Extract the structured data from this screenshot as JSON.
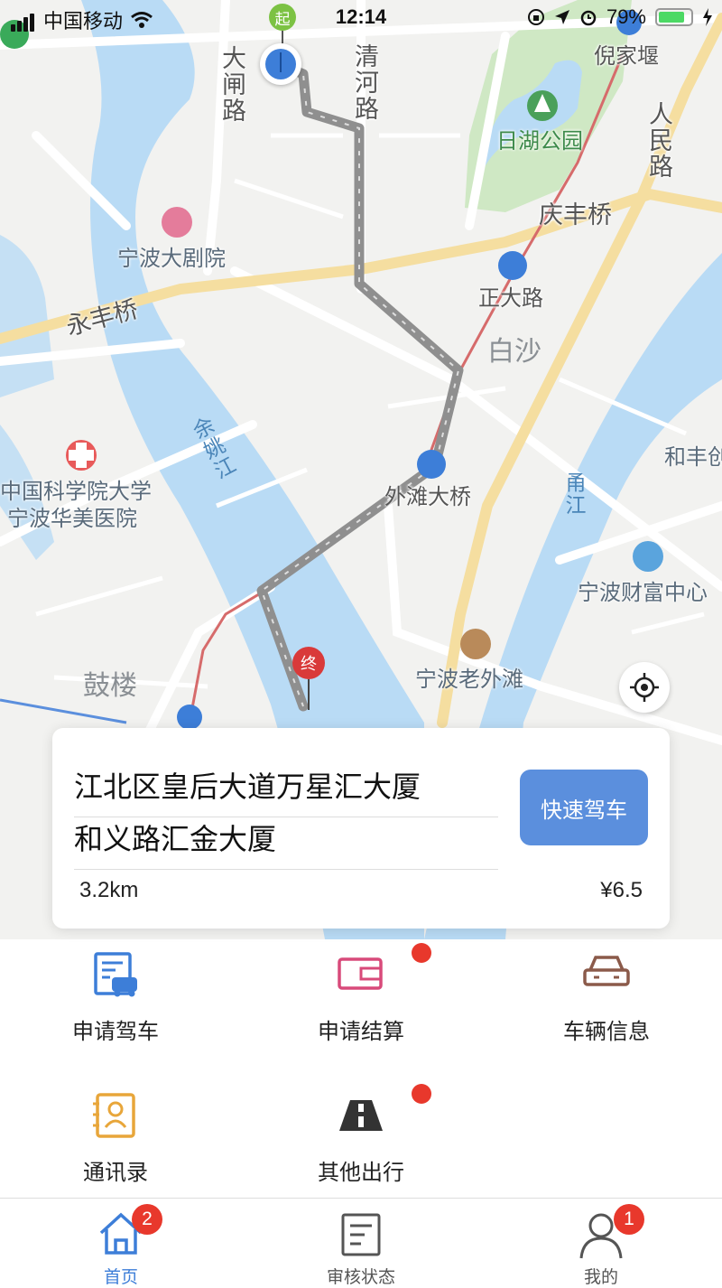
{
  "status_bar": {
    "carrier": "中国移动",
    "time": "12:14",
    "battery": "79%",
    "battery_level": 0.79
  },
  "map": {
    "start_marker": "起",
    "end_marker": "终",
    "road_labels": [
      "大闸路",
      "清河路",
      "人民路",
      "庆丰桥",
      "永丰桥",
      "正大路",
      "外滩大桥",
      "倪家堰"
    ],
    "poi_labels": [
      "宁波大剧院",
      "中国科学院大学",
      "宁波华美医院",
      "宁波财富中心",
      "宁波老外滩",
      "和丰创"
    ],
    "area_labels": [
      "白沙",
      "鼓楼"
    ],
    "park_label": "日湖公园",
    "rivers": [
      "余姚江",
      "甬江"
    ]
  },
  "trip_card": {
    "from": "江北区皇后大道万星汇大厦",
    "to": "和义路汇金大厦",
    "distance": "3.2km",
    "price": "¥6.5",
    "quick_button": "快速驾车"
  },
  "menu": {
    "items": [
      {
        "label": "申请驾车",
        "icon": "car-document-icon",
        "badge": false
      },
      {
        "label": "申请结算",
        "icon": "wallet-icon",
        "badge": true
      },
      {
        "label": "车辆信息",
        "icon": "car-icon",
        "badge": false
      },
      {
        "label": "通讯录",
        "icon": "contacts-icon",
        "badge": false
      },
      {
        "label": "其他出行",
        "icon": "road-icon",
        "badge": true
      }
    ]
  },
  "tabs": [
    {
      "label": "首页",
      "icon": "home-icon",
      "badge": "2",
      "active": true
    },
    {
      "label": "审核状态",
      "icon": "document-icon",
      "badge": "",
      "active": false
    },
    {
      "label": "我的",
      "icon": "user-icon",
      "badge": "1",
      "active": false
    }
  ],
  "colors": {
    "accent": "#5b8fdd",
    "tab_active": "#3d7ed8",
    "badge": "#e8382c",
    "river": "#b9dbf5",
    "park": "#cfe8c4",
    "route": "#8f8f8f"
  }
}
